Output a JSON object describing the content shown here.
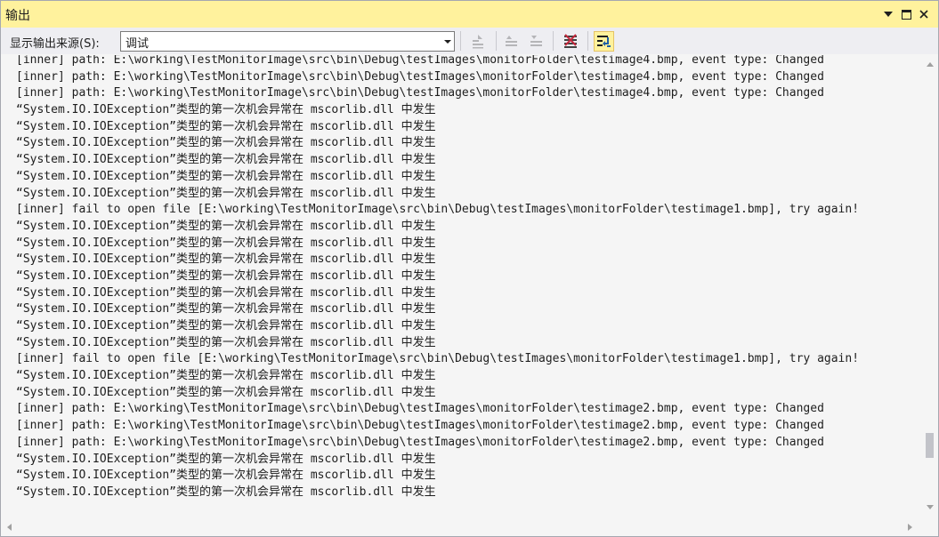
{
  "window": {
    "title": "输出"
  },
  "toolbar": {
    "source_label": "显示输出来源(S):",
    "source_value": "调试"
  },
  "output_lines": [
    "[inner] path: E:\\working\\TestMonitorImage\\src\\bin\\Debug\\testImages\\monitorFolder\\testimage4.bmp, event type: Changed",
    "[inner] path: E:\\working\\TestMonitorImage\\src\\bin\\Debug\\testImages\\monitorFolder\\testimage4.bmp, event type: Changed",
    "[inner] path: E:\\working\\TestMonitorImage\\src\\bin\\Debug\\testImages\\monitorFolder\\testimage4.bmp, event type: Changed",
    "“System.IO.IOException”类型的第一次机会异常在 mscorlib.dll 中发生",
    "“System.IO.IOException”类型的第一次机会异常在 mscorlib.dll 中发生",
    "“System.IO.IOException”类型的第一次机会异常在 mscorlib.dll 中发生",
    "“System.IO.IOException”类型的第一次机会异常在 mscorlib.dll 中发生",
    "“System.IO.IOException”类型的第一次机会异常在 mscorlib.dll 中发生",
    "“System.IO.IOException”类型的第一次机会异常在 mscorlib.dll 中发生",
    "[inner] fail to open file [E:\\working\\TestMonitorImage\\src\\bin\\Debug\\testImages\\monitorFolder\\testimage1.bmp], try again!",
    "“System.IO.IOException”类型的第一次机会异常在 mscorlib.dll 中发生",
    "“System.IO.IOException”类型的第一次机会异常在 mscorlib.dll 中发生",
    "“System.IO.IOException”类型的第一次机会异常在 mscorlib.dll 中发生",
    "“System.IO.IOException”类型的第一次机会异常在 mscorlib.dll 中发生",
    "“System.IO.IOException”类型的第一次机会异常在 mscorlib.dll 中发生",
    "“System.IO.IOException”类型的第一次机会异常在 mscorlib.dll 中发生",
    "“System.IO.IOException”类型的第一次机会异常在 mscorlib.dll 中发生",
    "“System.IO.IOException”类型的第一次机会异常在 mscorlib.dll 中发生",
    "[inner] fail to open file [E:\\working\\TestMonitorImage\\src\\bin\\Debug\\testImages\\monitorFolder\\testimage1.bmp], try again!",
    "“System.IO.IOException”类型的第一次机会异常在 mscorlib.dll 中发生",
    "“System.IO.IOException”类型的第一次机会异常在 mscorlib.dll 中发生",
    "[inner] path: E:\\working\\TestMonitorImage\\src\\bin\\Debug\\testImages\\monitorFolder\\testimage2.bmp, event type: Changed",
    "[inner] path: E:\\working\\TestMonitorImage\\src\\bin\\Debug\\testImages\\monitorFolder\\testimage2.bmp, event type: Changed",
    "[inner] path: E:\\working\\TestMonitorImage\\src\\bin\\Debug\\testImages\\monitorFolder\\testimage2.bmp, event type: Changed",
    "“System.IO.IOException”类型的第一次机会异常在 mscorlib.dll 中发生",
    "“System.IO.IOException”类型的第一次机会异常在 mscorlib.dll 中发生",
    "“System.IO.IOException”类型的第一次机会异常在 mscorlib.dll 中发生"
  ],
  "icons": {
    "dropdown": "window-dropdown-icon",
    "maximize": "maximize-icon",
    "close": "close-icon",
    "go_to_line": "go-to-line-icon",
    "prev_message": "previous-message-icon",
    "next_message": "next-message-icon",
    "clear_all": "clear-all-icon",
    "word_wrap": "word-wrap-toggle-icon"
  },
  "colors": {
    "title_bar": "#fff29d",
    "background": "#f5f5f5",
    "clear_icon_red": "#c5283d",
    "toggle_blue": "#1c5fa7"
  }
}
